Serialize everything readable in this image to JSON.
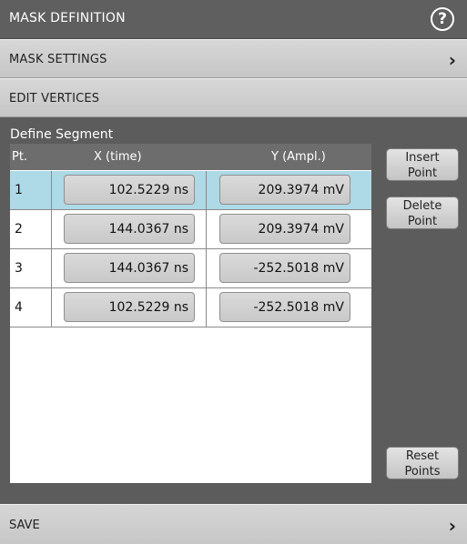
{
  "title": "MASK DEFINITION",
  "help_icon": "question-circle-icon",
  "sections": {
    "mask_settings": "MASK SETTINGS",
    "edit_vertices": "EDIT VERTICES",
    "save": "SAVE"
  },
  "define_segment": {
    "label": "Define Segment",
    "columns": [
      "Pt.",
      "X (time)",
      "Y (Ampl.)"
    ],
    "rows": [
      {
        "pt": "1",
        "x": "102.5229 ns",
        "y": "209.3974 mV",
        "selected": true
      },
      {
        "pt": "2",
        "x": "144.0367 ns",
        "y": "209.3974 mV",
        "selected": false
      },
      {
        "pt": "3",
        "x": "144.0367 ns",
        "y": "-252.5018 mV",
        "selected": false
      },
      {
        "pt": "4",
        "x": "102.5229 ns",
        "y": "-252.5018 mV",
        "selected": false
      }
    ]
  },
  "buttons": {
    "insert_line1": "Insert",
    "insert_line2": "Point",
    "delete_line1": "Delete",
    "delete_line2": "Point",
    "reset_line1": "Reset",
    "reset_line2": "Points"
  },
  "colors": {
    "selected_row": "#aed9e6",
    "header": "#6d6d6d"
  }
}
